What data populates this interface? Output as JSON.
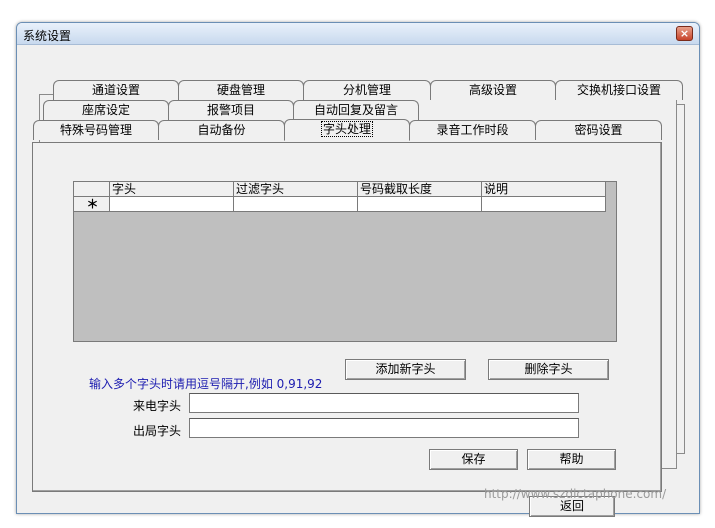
{
  "window": {
    "title": "系统设置",
    "close_glyph": "×"
  },
  "tabs": {
    "row1": [
      "通道设置",
      "硬盘管理",
      "分机管理",
      "高级设置",
      "交换机接口设置"
    ],
    "row2": [
      "座席设定",
      "报警项目",
      "自动回复及留言"
    ],
    "row3": [
      "特殊号码管理",
      "自动备份",
      "字头处理",
      "录音工作时段",
      "密码设置"
    ],
    "active": "字头处理"
  },
  "grid": {
    "columns": [
      "",
      "字头",
      "过滤字头",
      "号码截取长度",
      "说明"
    ],
    "new_row_indicator": "＊"
  },
  "buttons": {
    "add": "添加新字头",
    "delete": "删除字头",
    "save": "保存",
    "help": "帮助",
    "back": "返回"
  },
  "hint": "输入多个字头时请用逗号隔开,例如 0,91,92",
  "form": {
    "incoming_label": "来电字头",
    "incoming_value": "",
    "outgoing_label": "出局字头",
    "outgoing_value": ""
  },
  "watermark": "http://www.szdictaphone.com/"
}
